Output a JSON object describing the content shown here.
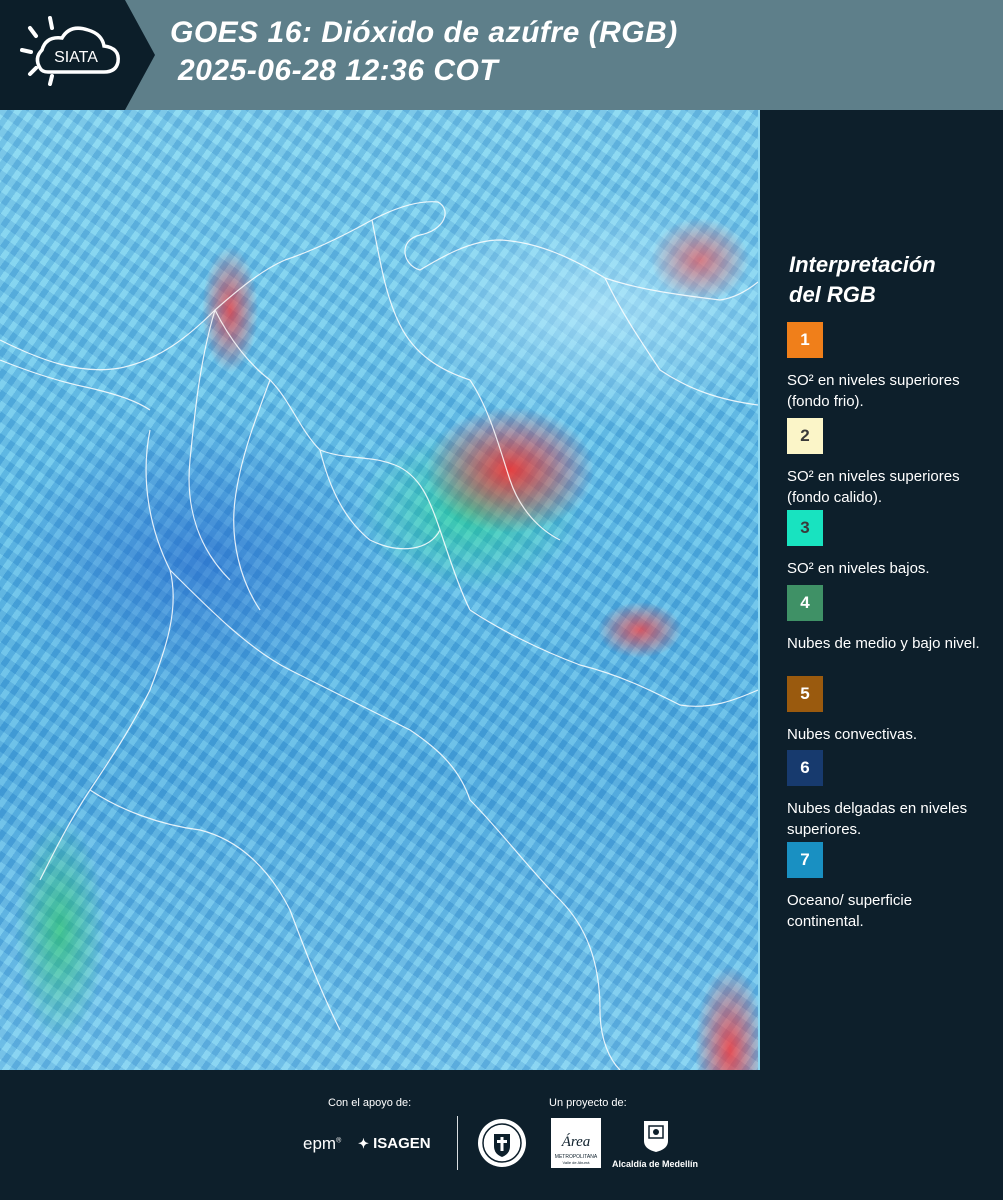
{
  "header": {
    "logo_text": "SIATA",
    "title_line1": "GOES 16: Dióxido de azúfre (RGB)",
    "title_line2": "2025-06-28 12:36 COT"
  },
  "legend": {
    "title_line1": "Interpretación",
    "title_line2": "del RGB",
    "items": [
      {
        "number": "1",
        "color": "#f07f1a",
        "number_color": "#ffffff",
        "text": "SO² en niveles superiores (fondo frio)."
      },
      {
        "number": "2",
        "color": "#fbf5c8",
        "number_color": "#3a3a3a",
        "text": "SO² en niveles superiores (fondo calido)."
      },
      {
        "number": "3",
        "color": "#18e3c0",
        "number_color": "#3a3a3a",
        "text": "SO² en niveles bajos."
      },
      {
        "number": "4",
        "color": "#3f9166",
        "number_color": "#ffffff",
        "text": "Nubes de medio y bajo nivel."
      },
      {
        "number": "5",
        "color": "#9a5a0e",
        "number_color": "#ffffff",
        "text": "Nubes convectivas."
      },
      {
        "number": "6",
        "color": "#173a6e",
        "number_color": "#ffffff",
        "text": "Nubes delgadas en niveles superiores."
      },
      {
        "number": "7",
        "color": "#1990c2",
        "number_color": "#ffffff",
        "text": "Oceano/ superficie continental."
      }
    ]
  },
  "footer": {
    "support_caption": "Con el apoyo de:",
    "project_caption": "Un proyecto de:",
    "partner_epm": "epm",
    "partner_isagen": "ISAGEN",
    "area_logo_text": "Área",
    "area_logo_subtext": "METROPOLITANA",
    "area_logo_subtext2": "Valle de Aburrá",
    "alcaldia_label": "Alcaldía de Medellín"
  },
  "colors": {
    "header_bg": "#5e7f8a",
    "page_bg": "#0d1f2b"
  }
}
